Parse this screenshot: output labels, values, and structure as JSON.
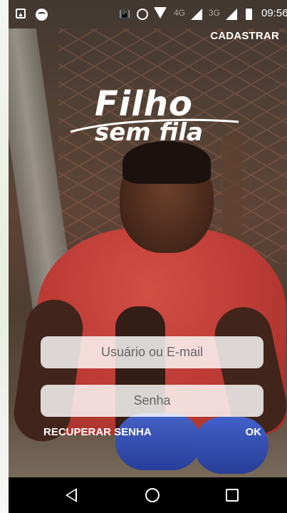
{
  "status_bar": {
    "time": "09:56",
    "network_1": "4G",
    "network_2": "3G",
    "icons": [
      "image-icon",
      "spotify-icon",
      "vibrate-icon",
      "alarm-icon",
      "wifi-icon",
      "signal-icon",
      "signal-icon",
      "battery-icon"
    ]
  },
  "header": {
    "register_label": "CADASTRAR"
  },
  "logo": {
    "line1": "Filho",
    "line2": "sem fila"
  },
  "form": {
    "user_placeholder": "Usuário ou E-mail",
    "password_placeholder": "Senha",
    "recover_label": "RECUPERAR SENHA",
    "ok_label": "OK"
  },
  "nav_bar": {
    "icons": [
      "back-icon",
      "home-icon",
      "recent-apps-icon"
    ]
  },
  "colors": {
    "nav_bar": "#000000",
    "shirt": "#d8453e",
    "field_bg": "#ffffff"
  }
}
